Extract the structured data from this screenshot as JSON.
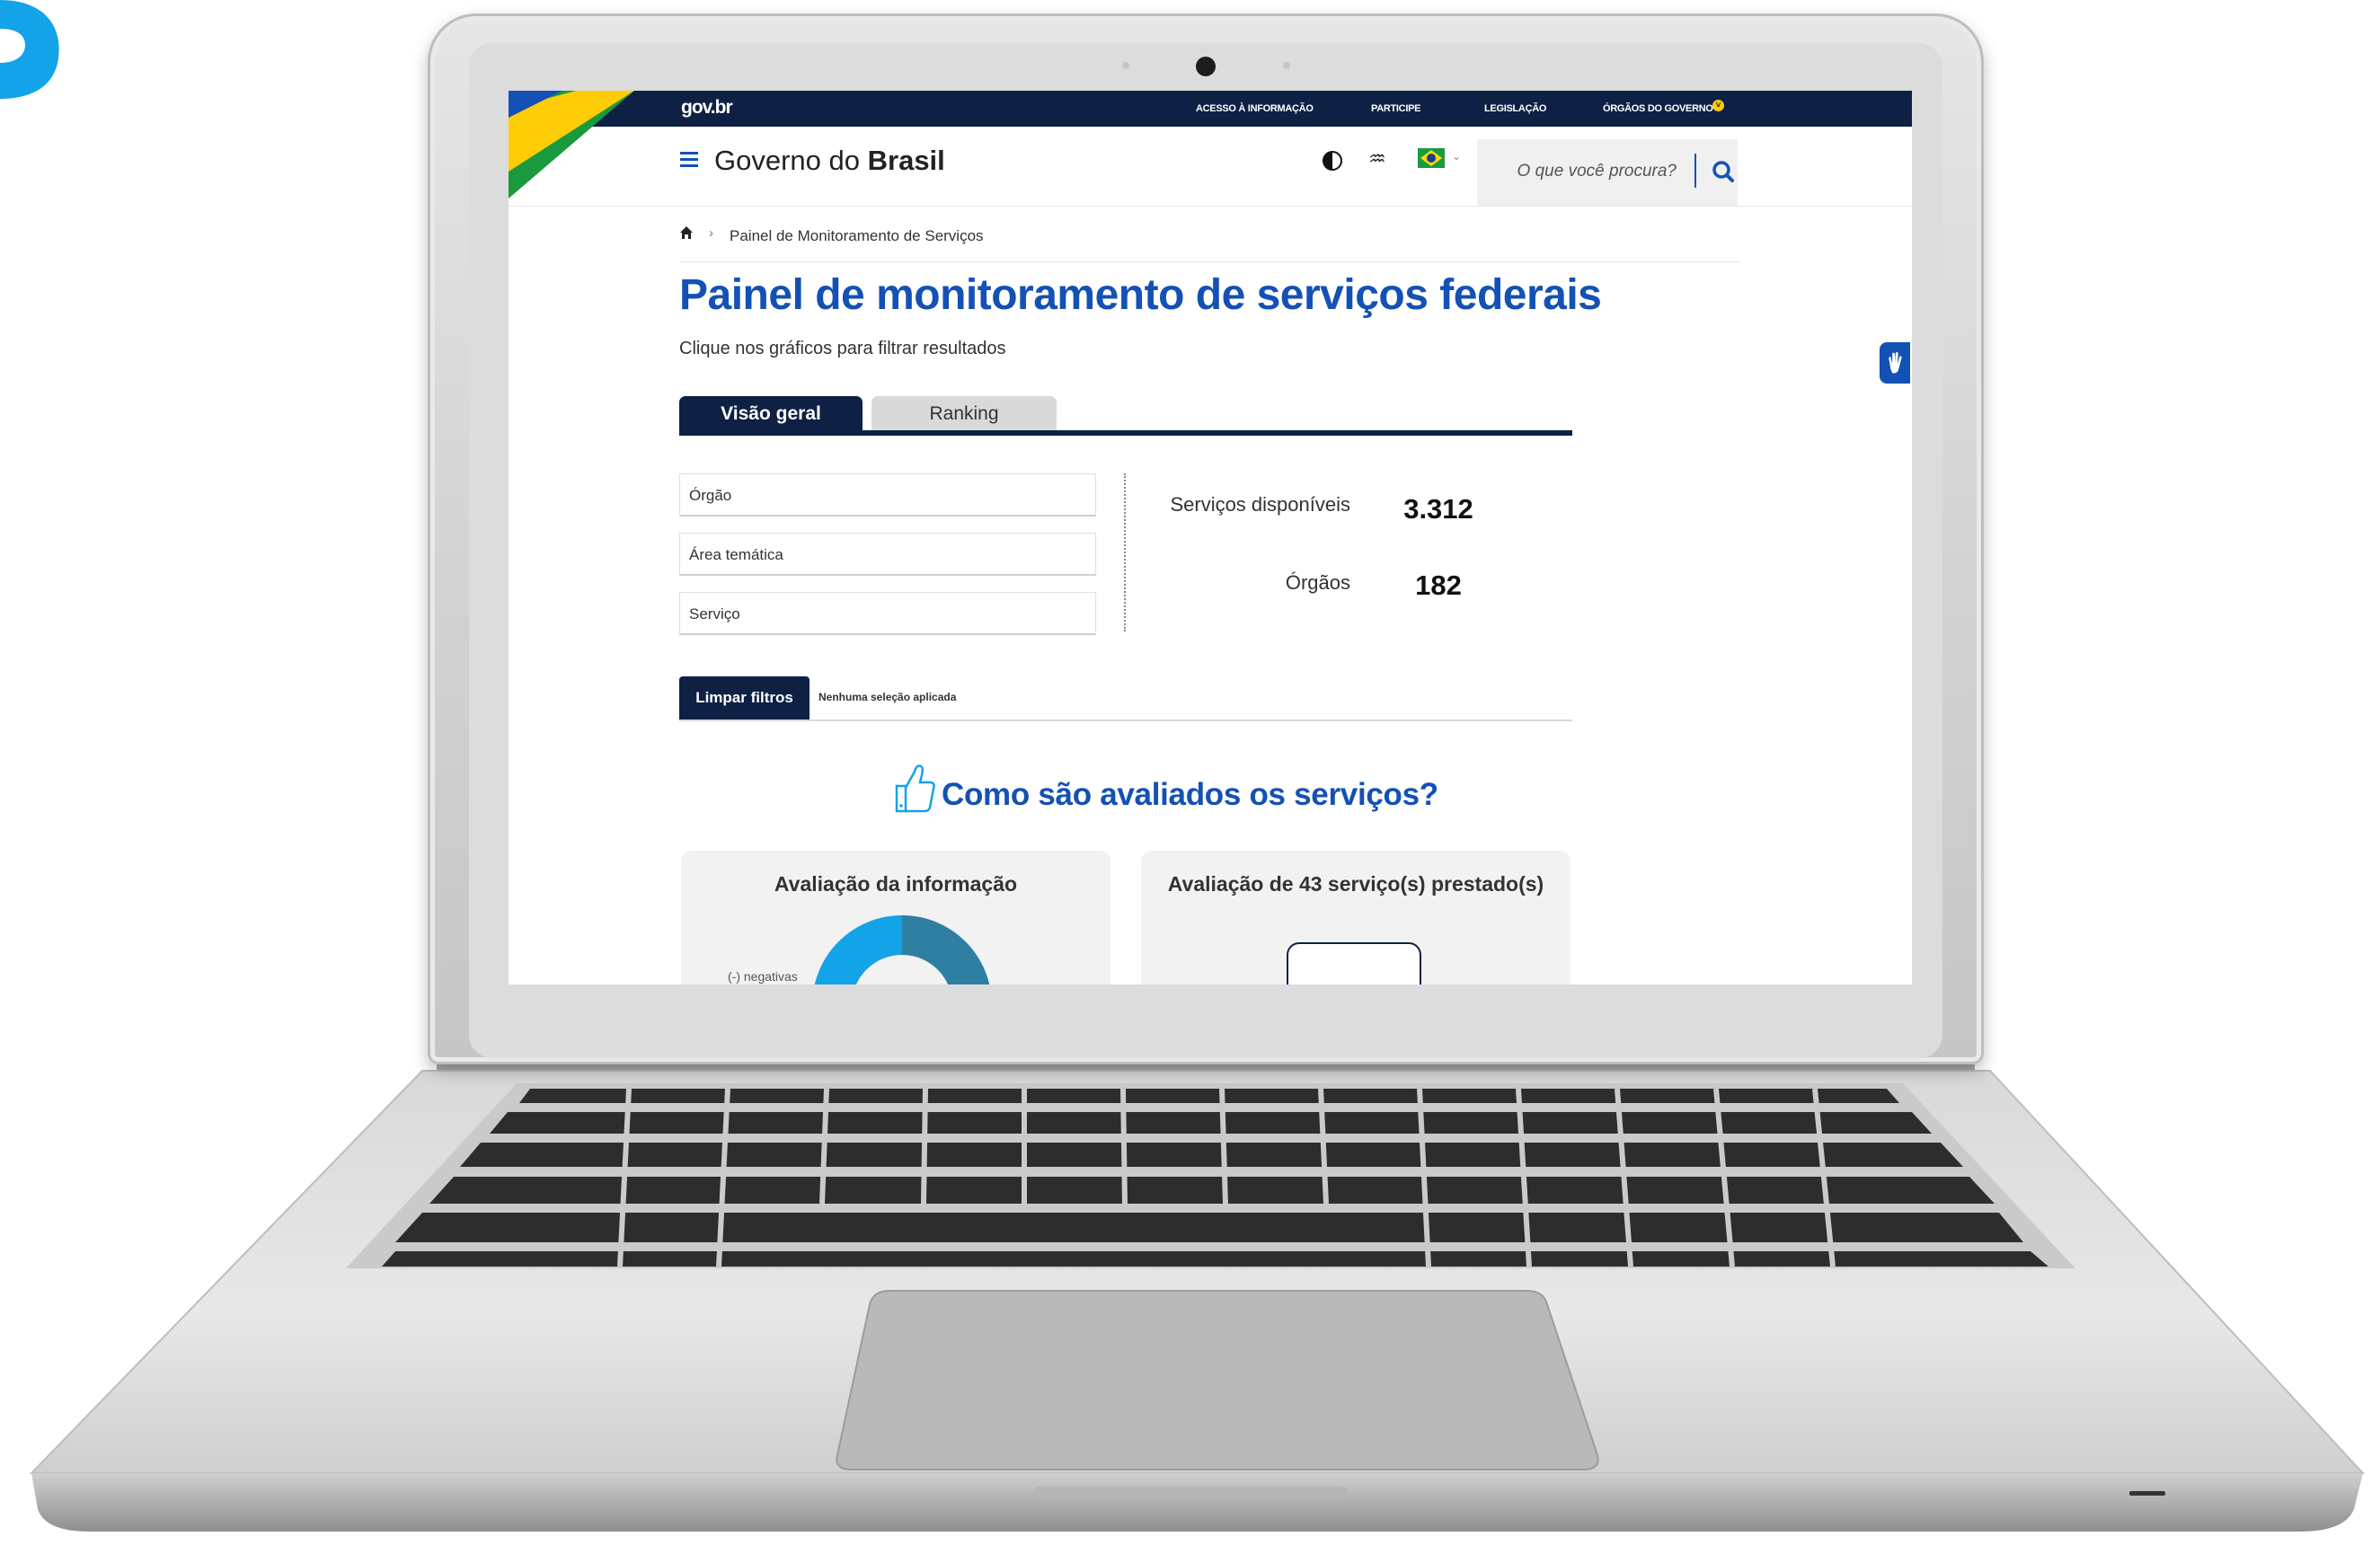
{
  "topbar": {
    "logo": "gov.br",
    "links": [
      "ACESSO À INFORMAÇÃO",
      "PARTICIPE",
      "LEGISLAÇÃO",
      "ÓRGÃOS DO GOVERNO"
    ]
  },
  "header": {
    "title_prefix": "Governo do",
    "title_bold": "Brasil",
    "search_placeholder": "O que você procura?",
    "icons": [
      "menu-icon",
      "contrast-icon",
      "hearing-icon",
      "brazil-flag-icon",
      "search-icon"
    ]
  },
  "breadcrumb": {
    "current": "Painel de Monitoramento de Serviços"
  },
  "page": {
    "title": "Painel de monitoramento de serviços federais",
    "subtitle": "Clique nos gráficos para filtrar resultados"
  },
  "tabs": [
    {
      "label": "Visão geral",
      "active": true
    },
    {
      "label": "Ranking",
      "active": false
    }
  ],
  "filters": {
    "orgao": "Órgão",
    "area": "Área temática",
    "servico": "Serviço"
  },
  "stats": {
    "servicos_label": "Serviços disponíveis",
    "servicos_value": "3.312",
    "orgaos_label": "Órgãos",
    "orgaos_value": "182"
  },
  "actions": {
    "limpar": "Limpar filtros",
    "status": "Nenhuma seleção aplicada"
  },
  "section": {
    "title": "Como são avaliados os serviços?"
  },
  "cards": {
    "info_title": "Avaliação da informação",
    "info_negative_label": "(-) negativas",
    "prestado_title": "Avaliação de 43 serviço(s) prestado(s)"
  },
  "colors": {
    "topbar": "#0e2144",
    "primary": "#1351b4",
    "donut_light": "#13a3e8",
    "donut_dark": "#2f7fa3"
  }
}
